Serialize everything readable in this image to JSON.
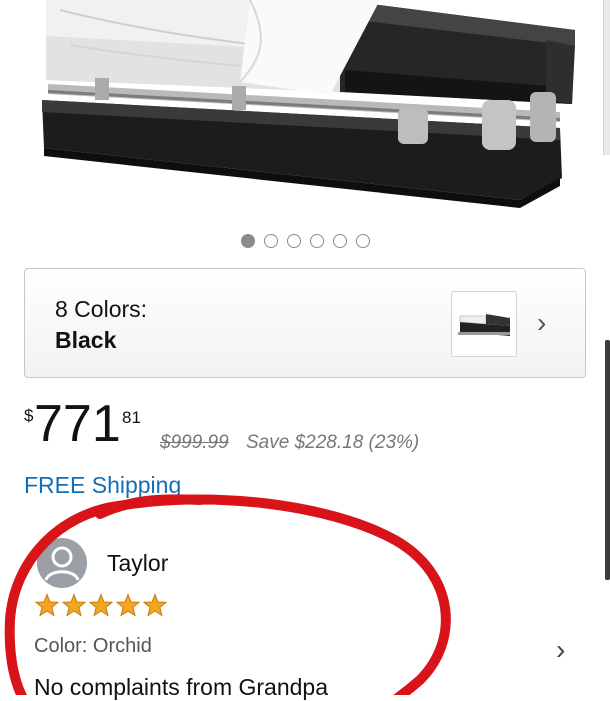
{
  "carousel": {
    "count": 6,
    "active_index": 0
  },
  "variant": {
    "count_label": "8 Colors:",
    "selected": "Black"
  },
  "price": {
    "symbol": "$",
    "whole": "771",
    "fraction": "81",
    "list_price": "$999.99",
    "savings": "Save $228.18 (23%)"
  },
  "shipping": {
    "label": "FREE Shipping"
  },
  "review": {
    "name": "Taylor",
    "rating": 5,
    "color": "Color: Orchid",
    "text": "No complaints from Grandpa"
  },
  "colors": {
    "link_blue": "#146eb4",
    "star_orange": "#f4a623",
    "annotation_red": "#d8141a"
  }
}
